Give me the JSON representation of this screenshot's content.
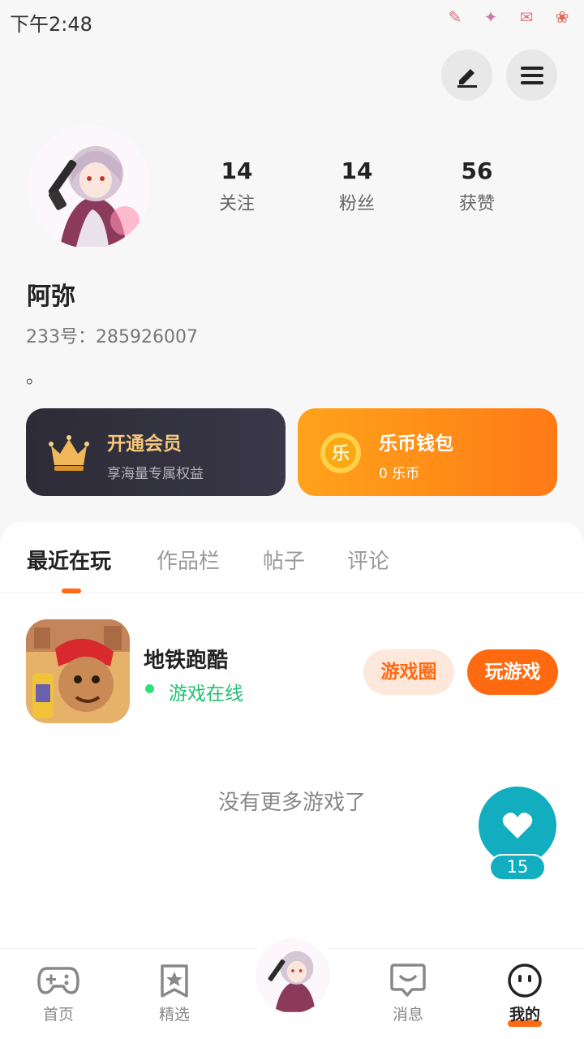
{
  "status_bar": {
    "time": "下午2:48",
    "icons": [
      "hammer-sticker-icon",
      "stars-sticker-icon",
      "mail-sticker-icon",
      "candy-sticker-icon"
    ]
  },
  "header_actions": {
    "edit_icon": "pencil-icon",
    "menu_icon": "hamburger-menu-icon"
  },
  "profile": {
    "avatar": "anime-girl-avatar",
    "name": "阿弥",
    "id_text": "233号：285926007",
    "bio": "。",
    "stats": [
      {
        "value": "14",
        "label": "关注"
      },
      {
        "value": "14",
        "label": "粉丝"
      },
      {
        "value": "56",
        "label": "获赞"
      }
    ]
  },
  "cards": {
    "vip": {
      "title": "开通会员",
      "subtitle": "享海量专属权益",
      "icon": "crown-icon"
    },
    "wallet": {
      "title": "乐币钱包",
      "subtitle": "0 乐币",
      "icon": "le-coin-icon",
      "coin_char": "乐"
    }
  },
  "tabs": [
    {
      "label": "最近在玩",
      "active": true
    },
    {
      "label": "作品栏",
      "active": false
    },
    {
      "label": "帖子",
      "active": false
    },
    {
      "label": "评论",
      "active": false
    }
  ],
  "games": [
    {
      "name": "地铁跑酷",
      "status": "游戏在线",
      "circle_button": "游戏圈",
      "play_button": "玩游戏"
    }
  ],
  "empty_text": "没有更多游戏了",
  "float_like": {
    "count": "15",
    "icon": "heart-icon"
  },
  "bottom_nav": [
    {
      "label": "首页",
      "icon": "gamepad-icon",
      "active": false
    },
    {
      "label": "精选",
      "icon": "star-bookmark-icon",
      "active": false
    },
    {
      "label": "",
      "icon": "center-avatar-icon",
      "active": false
    },
    {
      "label": "消息",
      "icon": "chat-bubble-icon",
      "active": false
    },
    {
      "label": "我的",
      "icon": "smiley-face-icon",
      "active": true
    }
  ],
  "colors": {
    "accent": "#ff6a10",
    "teal": "#12aebf",
    "online": "#20c070",
    "vip_gold": "#f4c77a"
  }
}
